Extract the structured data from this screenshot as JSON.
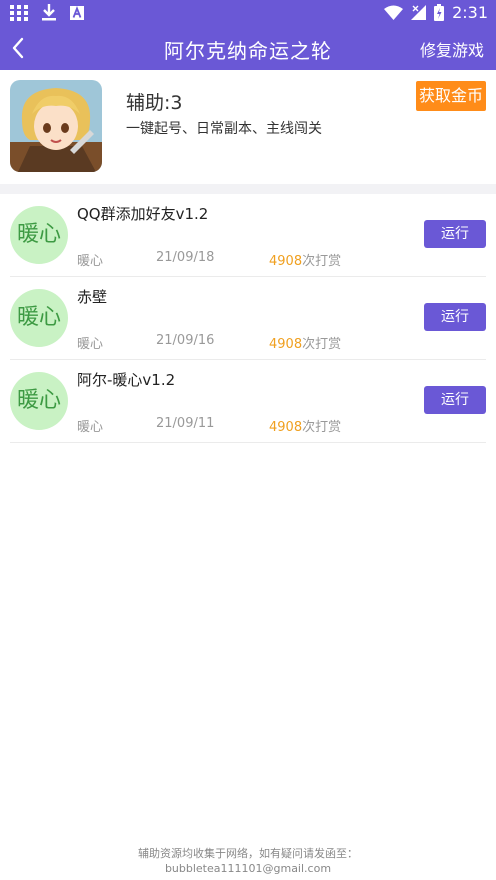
{
  "status_bar": {
    "time": "2:31",
    "icons": [
      "grid-icon",
      "download-icon",
      "a-icon",
      "wifi-icon",
      "signal-icon",
      "battery-icon"
    ]
  },
  "header_bar": {
    "title": "阿尔克纳命运之轮",
    "right_action": "修复游戏",
    "bg_color": "#6a58d6"
  },
  "game": {
    "aux_count": "辅助:3",
    "description": "一键起号、日常副本、主线闯关",
    "coin_button": "获取金币",
    "coin_color": "#ff8c19"
  },
  "scripts": [
    {
      "avatar_text": "暖心",
      "title": "QQ群添加好友v1.2",
      "author": "暖心",
      "date": "21/09/18",
      "reward_num": "4908",
      "reward_suffix": "次打赏",
      "run_label": "运行"
    },
    {
      "avatar_text": "暖心",
      "title": "赤壁",
      "author": "暖心",
      "date": "21/09/16",
      "reward_num": "4908",
      "reward_suffix": "次打赏",
      "run_label": "运行"
    },
    {
      "avatar_text": "暖心",
      "title": "阿尔-暖心v1.2",
      "author": "暖心",
      "date": "21/09/11",
      "reward_num": "4908",
      "reward_suffix": "次打赏",
      "run_label": "运行"
    }
  ],
  "footer": {
    "line1": "辅助资源均收集于网络，如有疑问请发函至：",
    "line2": "bubbletea111101@gmail.com"
  }
}
